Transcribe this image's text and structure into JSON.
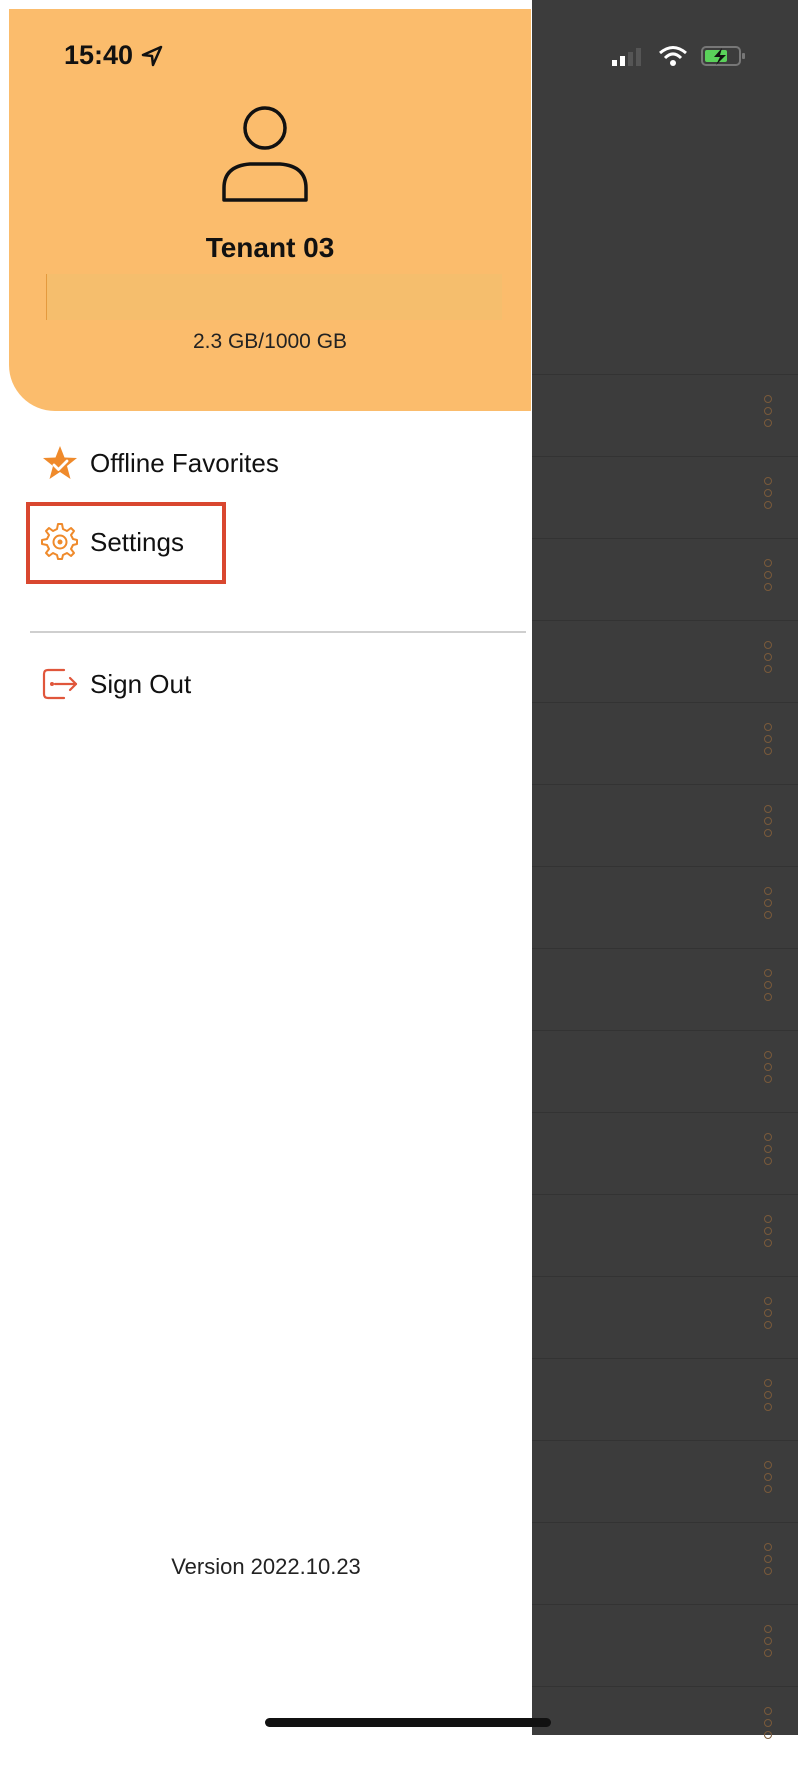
{
  "status_bar": {
    "time": "15:40"
  },
  "profile": {
    "tenant_name": "Tenant 03",
    "storage_usage": "2.3 GB/1000 GB",
    "storage_used_fraction": 0.0023
  },
  "menu": {
    "items": [
      {
        "label": "Offline Favorites",
        "icon": "star-check-icon"
      },
      {
        "label": "Settings",
        "icon": "gear-icon"
      }
    ],
    "sign_out": {
      "label": "Sign Out",
      "icon": "sign-out-icon"
    }
  },
  "footer": {
    "version": "Version 2022.10.23"
  },
  "colors": {
    "header_bg": "#fbbc6c",
    "accent": "#ef8a2b",
    "highlight": "#d9472f",
    "backdrop": "#3c3c3c"
  }
}
